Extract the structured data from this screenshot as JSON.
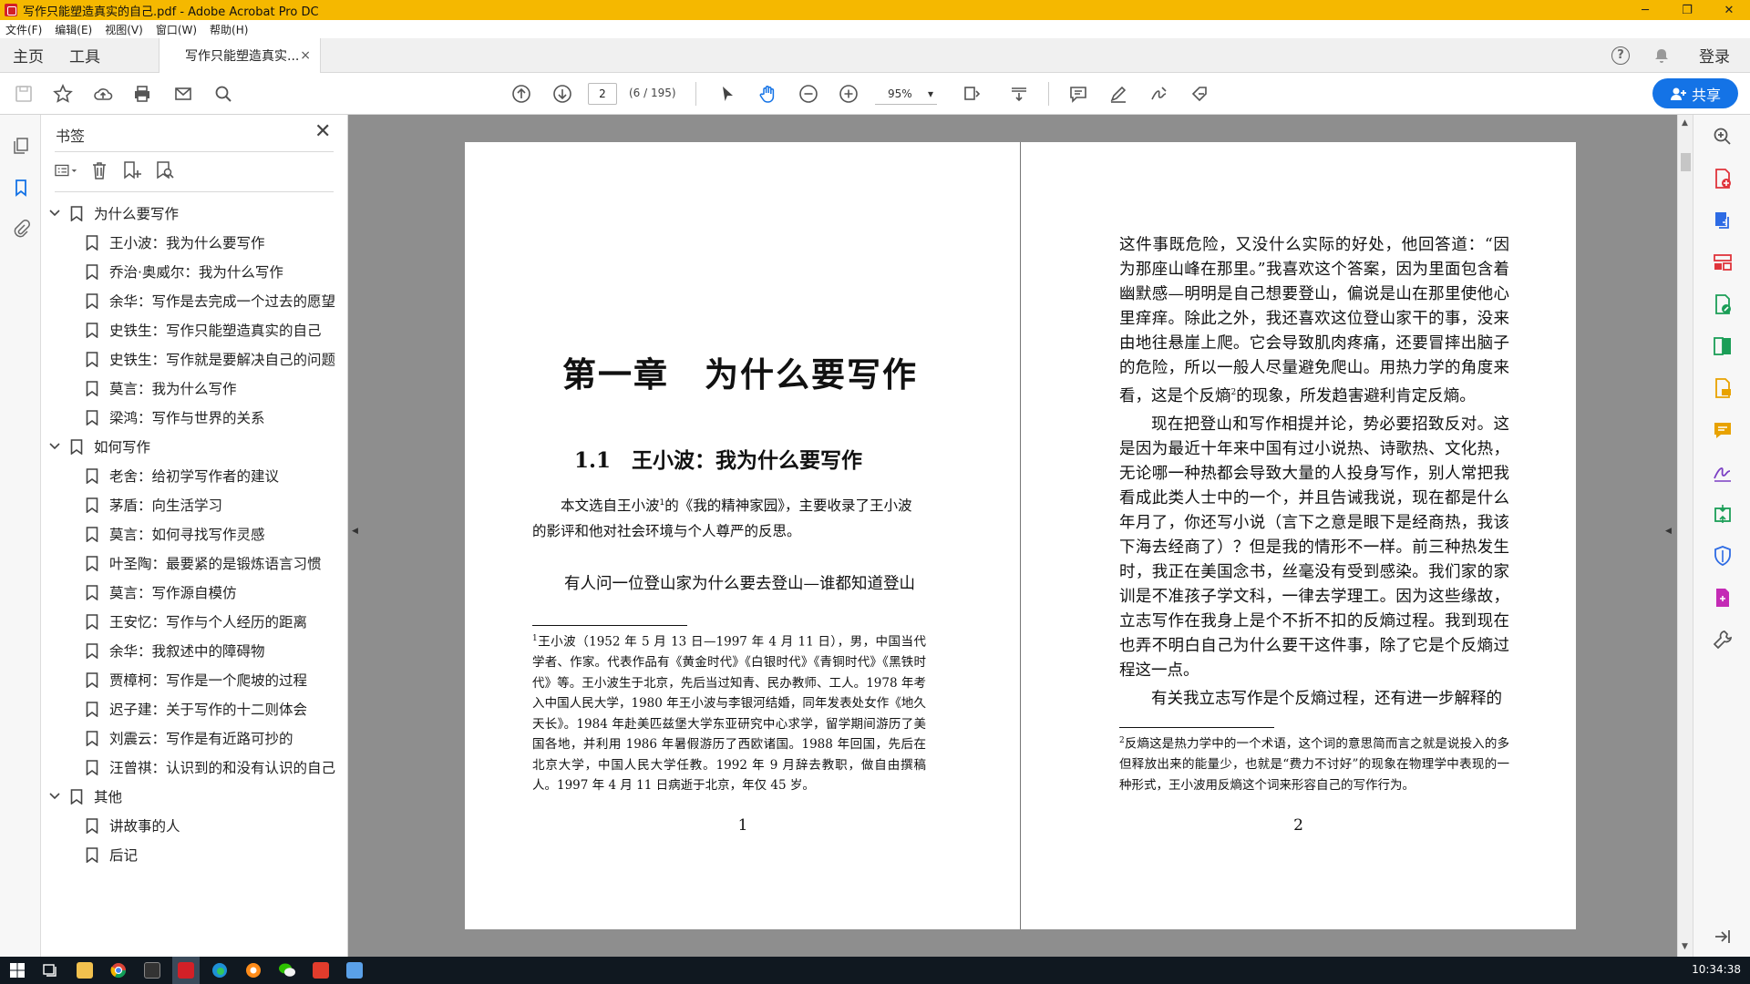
{
  "window": {
    "title": "写作只能塑造真实的自己.pdf - Adobe Acrobat Pro DC",
    "controls": {
      "minimize": "─",
      "maximize": "❐",
      "close": "✕"
    }
  },
  "menubar": [
    "文件(F)",
    "编辑(E)",
    "视图(V)",
    "窗口(W)",
    "帮助(H)"
  ],
  "tabs": {
    "home": "主页",
    "tools": "工具",
    "document": "写作只能塑造真实...",
    "close": "×",
    "help": "?",
    "login": "登录"
  },
  "toolbar": {
    "current_page": "2",
    "page_count": "(6 / 195)",
    "zoom": "95%",
    "zoom_caret": "▾",
    "share": "共享"
  },
  "bookmarks": {
    "title": "书签",
    "close": "✕",
    "groups": [
      {
        "label": "为什么要写作",
        "items": [
          "王小波：我为什么要写作",
          "乔治·奥威尔：我为什么写作",
          "余华：写作是去完成一个过去的愿望",
          "史铁生：写作只能塑造真实的自己",
          "史铁生：写作就是要解决自己的问题",
          "莫言：我为什么写作",
          "梁鸿：写作与世界的关系"
        ]
      },
      {
        "label": "如何写作",
        "items": [
          "老舍：给初学写作者的建议",
          "茅盾：向生活学习",
          "莫言：如何寻找写作灵感",
          "叶圣陶：最要紧的是锻炼语言习惯",
          "莫言：写作源自模仿",
          "王安忆：写作与个人经历的距离",
          "余华：我叙述中的障碍物",
          "贾樟柯：写作是一个爬坡的过程",
          "迟子建：关于写作的十二则体会",
          "刘震云：写作是有近路可抄的",
          "汪曾祺：认识到的和没有认识的自己"
        ]
      },
      {
        "label": "其他",
        "items": [
          "讲故事的人",
          "后记"
        ]
      }
    ]
  },
  "page_left": {
    "chapter_title": "第一章　为什么要写作",
    "section_title": "1.1　王小波：我为什么要写作",
    "intro_a": "本文选自王小波",
    "intro_sup": "1",
    "intro_b": "的《我的精神家园》，主要收录了王小波的影评和他对社会环境与个人尊严的反思。",
    "body": "有人问一位登山家为什么要去登山—谁都知道登山",
    "footnote_sup": "1",
    "footnote": "王小波（1952 年 5 月 13 日—1997 年 4 月 11 日），男，中国当代学者、作家。代表作品有《黄金时代》《白银时代》《青铜时代》《黑铁时代》等。王小波生于北京，先后当过知青、民办教师、工人。1978 年考入中国人民大学，1980 年王小波与李银河结婚，同年发表处女作《地久天长》。1984 年赴美匹兹堡大学东亚研究中心求学，留学期间游历了美国各地，并利用 1986 年暑假游历了西欧诸国。1988 年回国，先后在北京大学，中国人民大学任教。1992 年 9 月辞去教职，做自由撰稿人。1997 年 4 月 11 日病逝于北京，年仅 45 岁。",
    "page_number": "1"
  },
  "page_right": {
    "p1_a": "这件事既危险，又没什么实际的好处，他回答道：“因为那座山峰在那里。”我喜欢这个答案，因为里面包含着幽默感—明明是自己想要登山，偏说是山在那里使他心里痒痒。除此之外，我还喜欢这位登山家干的事，没来由地往悬崖上爬。它会导致肌肉疼痛，还要冒摔出脑子的危险，所以一般人尽量避免爬山。用热力学的角度来看，这是个反熵",
    "p1_sup": "2",
    "p1_b": "的现象，所发趋害避利肯定反熵。",
    "p2": "现在把登山和写作相提并论，势必要招致反对。这是因为最近十年来中国有过小说热、诗歌热、文化热，无论哪一种热都会导致大量的人投身写作，别人常把我看成此类人士中的一个，并且告诫我说，现在都是什么年月了，你还写小说（言下之意是眼下是经商热，我该下海去经商了）？但是我的情形不一样。前三种热发生时，我正在美国念书，丝毫没有受到感染。我们家的家训是不准孩子学文科，一律去学理工。因为这些缘故，立志写作在我身上是个不折不扣的反熵过程。我到现在也弄不明白自己为什么要干这件事，除了它是个反熵过程这一点。",
    "p3": "有关我立志写作是个反熵过程，还有进一步解释的",
    "footnote_sup": "2",
    "footnote": "反熵这是热力学中的一个术语，这个词的意思简而言之就是说投入的多但释放出来的能量少，也就是“费力不讨好”的现象在物理学中表现的一种形式，王小波用反熵这个词来形容自己的写作行为。",
    "page_number": "2"
  },
  "taskbar": {
    "clock": "10:34:38"
  },
  "colors": {
    "titlebar": "#f5b800",
    "accent": "#1473e6",
    "taskbar": "#101820"
  }
}
